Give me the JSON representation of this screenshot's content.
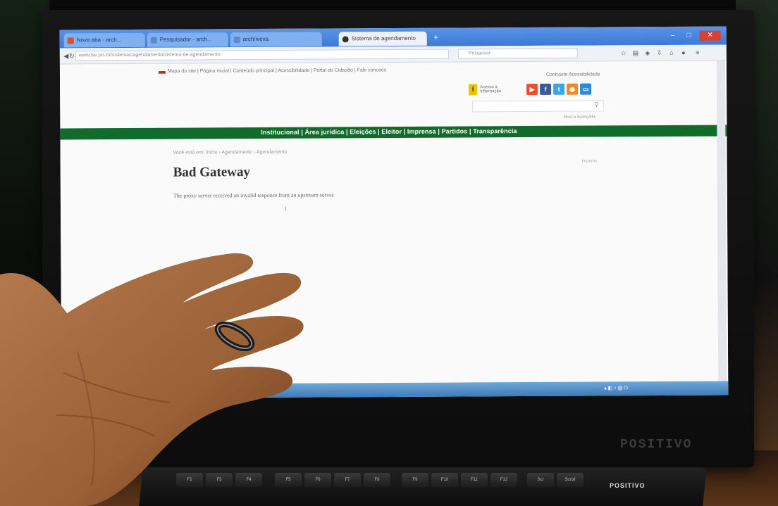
{
  "scene": {
    "monitor_brand": "POSITIVO",
    "keyboard_brand": "POSITIVO"
  },
  "browser": {
    "tabs": [
      {
        "label": "Nova aba - arch..."
      },
      {
        "label": "Pesquisador - arch..."
      },
      {
        "label": "arch/ivexa"
      },
      {
        "label": "Sistema de agendamento"
      }
    ],
    "url": "www.tse.jus.br/sistemas/agendamento/sistema-de-agendamento",
    "search_placeholder": "Pesquisar"
  },
  "site": {
    "top_nav": "Mapa do site | Página inicial | Conteúdo principal | Acessibilidade | Portal do Cidadão | Fale conosco",
    "top_links": "Contraste  Acessibilidade",
    "acesso_label": "Acesso à Informação",
    "social": [
      "YouTube",
      "Facebook",
      "Twitter",
      "RSS",
      "Flickr"
    ],
    "busca_avancada": "Busca avançada",
    "menu": [
      "Institucional",
      "Área jurídica",
      "Eleições",
      "Eleitor",
      "Imprensa",
      "Partidos",
      "Transparência"
    ],
    "breadcrumb": "Você está em: Início › Agendamento › Agendamento",
    "print_label": "Imprimir",
    "error_title": "Bad Gateway",
    "error_message": "The proxy server received an invalid response from an upstream server."
  },
  "colors": {
    "site_green": "#116b2b",
    "browser_blue": "#3d79d6",
    "taskbar_blue": "#3f7ab8"
  }
}
